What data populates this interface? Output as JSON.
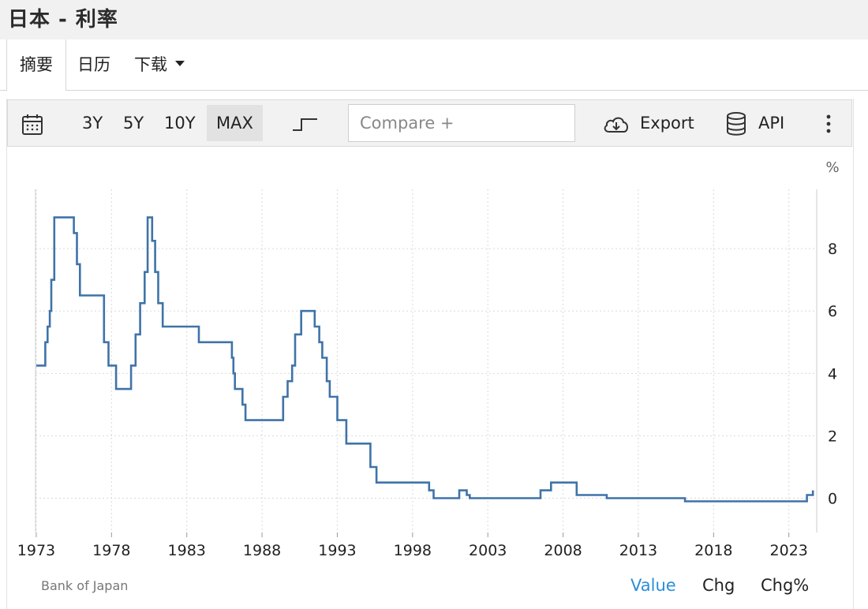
{
  "header": {
    "title": "日本 - 利率"
  },
  "tabs": [
    {
      "label": "摘要"
    },
    {
      "label": "日历"
    },
    {
      "label": "下载"
    }
  ],
  "toolbar": {
    "ranges": [
      "3Y",
      "5Y",
      "10Y",
      "MAX"
    ],
    "selected_range": "MAX",
    "compare_placeholder": "Compare +",
    "export_label": "Export",
    "api_label": "API",
    "icons": [
      "calendar-icon",
      "step-chart-icon",
      "cloud-download-icon",
      "database-icon",
      "more-vertical-icon"
    ]
  },
  "footer": {
    "source": "Bank of Japan",
    "modes": [
      "Value",
      "Chg",
      "Chg%"
    ],
    "active_mode": "Value",
    "active_color": "#2a8fd8"
  },
  "chart_data": {
    "type": "line",
    "title": "",
    "xlabel": "",
    "ylabel": "%",
    "line_color": "#3f73a8",
    "interpolation": "step",
    "xlim": [
      1972.95,
      2024.85
    ],
    "ylim": [
      -1.1,
      9.9
    ],
    "x_ticks": [
      1973,
      1978,
      1983,
      1988,
      1993,
      1998,
      2003,
      2008,
      2013,
      2018,
      2023
    ],
    "x_tick_labels": [
      "1973",
      "1978",
      "1983",
      "1988",
      "1993",
      "1998",
      "2003",
      "2008",
      "2013",
      "2018",
      "2023"
    ],
    "y_ticks": [
      0,
      2,
      4,
      6,
      8
    ],
    "y_tick_labels": [
      "0",
      "2",
      "4",
      "6",
      "8"
    ],
    "y_axis_position": "right",
    "grid": true,
    "series": [
      {
        "x": [
          1973.0,
          1973.5,
          1973.6,
          1973.75,
          1973.9,
          1974.0,
          1974.2,
          1975.5,
          1975.7,
          1975.9,
          1976.2,
          1977.5,
          1977.8,
          1978.3,
          1979.3,
          1979.6,
          1979.9,
          1980.2,
          1980.4,
          1980.7,
          1980.9,
          1981.1,
          1981.4,
          1982.1,
          1983.8,
          1986.0,
          1986.1,
          1986.2,
          1986.4,
          1986.7,
          1986.9,
          1987.1,
          1989.4,
          1989.7,
          1990.0,
          1990.2,
          1990.6,
          1991.5,
          1991.8,
          1992.0,
          1992.3,
          1992.5,
          1993.0,
          1993.6,
          1995.2,
          1995.6,
          1996.0,
          1999.1,
          1999.4,
          2001.1,
          2001.6,
          2001.8,
          2006.5,
          2007.2,
          2008.9,
          2009.2,
          2010.9,
          2016.1,
          2024.2,
          2024.6
        ],
        "y": [
          4.25,
          4.25,
          5.0,
          5.5,
          6.0,
          7.0,
          9.0,
          8.5,
          7.5,
          6.5,
          6.5,
          5.0,
          4.25,
          3.5,
          4.25,
          5.25,
          6.25,
          7.25,
          9.0,
          8.25,
          7.25,
          6.25,
          5.5,
          5.5,
          5.0,
          4.5,
          4.0,
          3.5,
          3.5,
          3.0,
          2.5,
          2.5,
          3.25,
          3.75,
          4.25,
          5.25,
          6.0,
          5.5,
          5.0,
          4.5,
          3.75,
          3.25,
          2.5,
          1.75,
          1.0,
          0.5,
          0.5,
          0.25,
          0.0,
          0.25,
          0.1,
          0.0,
          0.25,
          0.5,
          0.1,
          0.1,
          0.0,
          -0.1,
          0.1,
          0.25
        ]
      }
    ]
  }
}
